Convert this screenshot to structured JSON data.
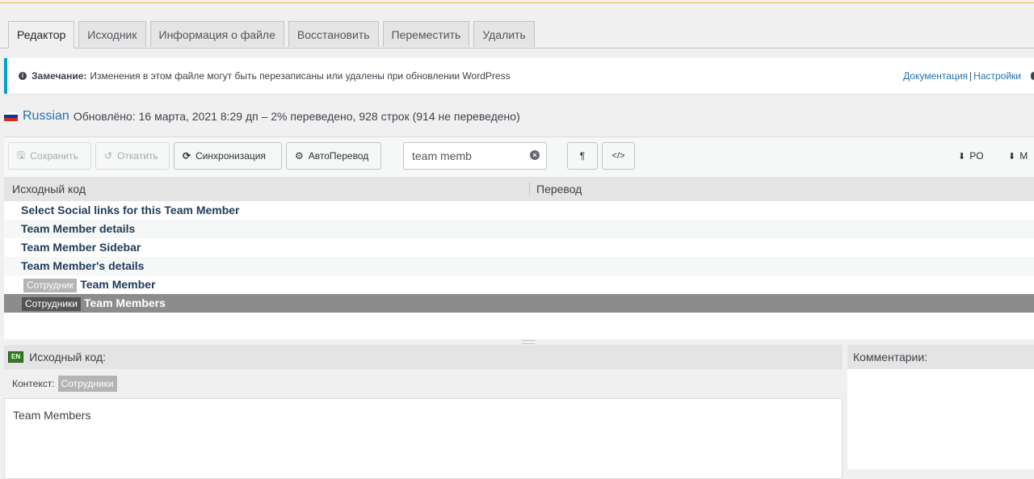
{
  "tabs": [
    "Редактор",
    "Исходник",
    "Информация о файле",
    "Восстановить",
    "Переместить",
    "Удалить"
  ],
  "notice": {
    "label": "Замечание:",
    "text": "Изменения в этом файле могут быть перезаписаны или удалены при обновлении WordPress",
    "link_docs": "Документация",
    "separator": "|",
    "link_settings": "Настройки"
  },
  "language": {
    "name": "Russian",
    "status": "Обновлёно: 16 марта, 2021 8:29 дп – 2% переведено, 928 строк (914 не переведено)"
  },
  "toolbar": {
    "save": "Сохранить",
    "revert": "Откатить",
    "sync": "Синхронизация",
    "auto": "АвтоПеревод",
    "search_value": "team memb",
    "pilcrow": "¶",
    "code": "</>",
    "download_po": "PO",
    "download_mo": "M"
  },
  "table": {
    "col_source": "Исходный код",
    "col_translation": "Перевод",
    "rows": [
      {
        "context": "",
        "text": "Select Social links for this Team Member"
      },
      {
        "context": "",
        "text": "Team Member details"
      },
      {
        "context": "",
        "text": "Team Member Sidebar"
      },
      {
        "context": "",
        "text": "Team Member's details"
      },
      {
        "context": "Сотрудник",
        "text": "Team Member"
      },
      {
        "context": "Сотрудники",
        "text": "Team Members"
      }
    ]
  },
  "source_pane": {
    "lang_badge": "EN",
    "title": "Исходный код:",
    "context_label": "Контекст:",
    "context_value": "Сотрудники",
    "text": "Team Members"
  },
  "comments_pane": {
    "title": "Комментарии:"
  },
  "colors": {
    "accent": "#2271b1",
    "notice_border": "#00a0d2",
    "selected_row": "#8c8c8c"
  }
}
